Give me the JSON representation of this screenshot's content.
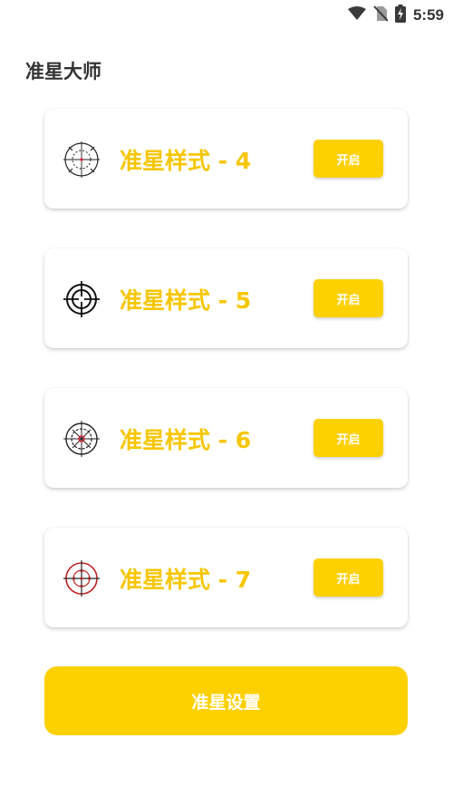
{
  "status_bar": {
    "time": "5:59",
    "icons": [
      "wifi-icon",
      "no-sim-icon",
      "battery-charging-icon"
    ]
  },
  "app": {
    "title": "准星大师"
  },
  "crosshairs": [
    {
      "label": "准星样式 - 4",
      "button": "开启",
      "icon": "crosshair-style-4-icon"
    },
    {
      "label": "准星样式 - 5",
      "button": "开启",
      "icon": "crosshair-style-5-icon"
    },
    {
      "label": "准星样式 - 6",
      "button": "开启",
      "icon": "crosshair-style-6-icon"
    },
    {
      "label": "准星样式 - 7",
      "button": "开启",
      "icon": "crosshair-style-7-icon"
    }
  ],
  "settings_button": "准星设置",
  "colors": {
    "accent": "#fdd000",
    "label": "#f7c600",
    "title": "#333333"
  }
}
